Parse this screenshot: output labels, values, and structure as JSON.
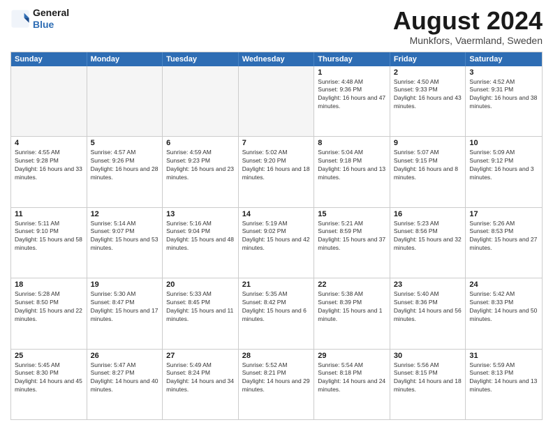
{
  "header": {
    "logo_line1": "General",
    "logo_line2": "Blue",
    "month_title": "August 2024",
    "location": "Munkfors, Vaermland, Sweden"
  },
  "days_of_week": [
    "Sunday",
    "Monday",
    "Tuesday",
    "Wednesday",
    "Thursday",
    "Friday",
    "Saturday"
  ],
  "weeks": [
    [
      {
        "day": "",
        "empty": true
      },
      {
        "day": "",
        "empty": true
      },
      {
        "day": "",
        "empty": true
      },
      {
        "day": "",
        "empty": true
      },
      {
        "day": "1",
        "sunrise": "4:48 AM",
        "sunset": "9:36 PM",
        "daylight": "16 hours and 47 minutes."
      },
      {
        "day": "2",
        "sunrise": "4:50 AM",
        "sunset": "9:33 PM",
        "daylight": "16 hours and 43 minutes."
      },
      {
        "day": "3",
        "sunrise": "4:52 AM",
        "sunset": "9:31 PM",
        "daylight": "16 hours and 38 minutes."
      }
    ],
    [
      {
        "day": "4",
        "sunrise": "4:55 AM",
        "sunset": "9:28 PM",
        "daylight": "16 hours and 33 minutes."
      },
      {
        "day": "5",
        "sunrise": "4:57 AM",
        "sunset": "9:26 PM",
        "daylight": "16 hours and 28 minutes."
      },
      {
        "day": "6",
        "sunrise": "4:59 AM",
        "sunset": "9:23 PM",
        "daylight": "16 hours and 23 minutes."
      },
      {
        "day": "7",
        "sunrise": "5:02 AM",
        "sunset": "9:20 PM",
        "daylight": "16 hours and 18 minutes."
      },
      {
        "day": "8",
        "sunrise": "5:04 AM",
        "sunset": "9:18 PM",
        "daylight": "16 hours and 13 minutes."
      },
      {
        "day": "9",
        "sunrise": "5:07 AM",
        "sunset": "9:15 PM",
        "daylight": "16 hours and 8 minutes."
      },
      {
        "day": "10",
        "sunrise": "5:09 AM",
        "sunset": "9:12 PM",
        "daylight": "16 hours and 3 minutes."
      }
    ],
    [
      {
        "day": "11",
        "sunrise": "5:11 AM",
        "sunset": "9:10 PM",
        "daylight": "15 hours and 58 minutes."
      },
      {
        "day": "12",
        "sunrise": "5:14 AM",
        "sunset": "9:07 PM",
        "daylight": "15 hours and 53 minutes."
      },
      {
        "day": "13",
        "sunrise": "5:16 AM",
        "sunset": "9:04 PM",
        "daylight": "15 hours and 48 minutes."
      },
      {
        "day": "14",
        "sunrise": "5:19 AM",
        "sunset": "9:02 PM",
        "daylight": "15 hours and 42 minutes."
      },
      {
        "day": "15",
        "sunrise": "5:21 AM",
        "sunset": "8:59 PM",
        "daylight": "15 hours and 37 minutes."
      },
      {
        "day": "16",
        "sunrise": "5:23 AM",
        "sunset": "8:56 PM",
        "daylight": "15 hours and 32 minutes."
      },
      {
        "day": "17",
        "sunrise": "5:26 AM",
        "sunset": "8:53 PM",
        "daylight": "15 hours and 27 minutes."
      }
    ],
    [
      {
        "day": "18",
        "sunrise": "5:28 AM",
        "sunset": "8:50 PM",
        "daylight": "15 hours and 22 minutes."
      },
      {
        "day": "19",
        "sunrise": "5:30 AM",
        "sunset": "8:47 PM",
        "daylight": "15 hours and 17 minutes."
      },
      {
        "day": "20",
        "sunrise": "5:33 AM",
        "sunset": "8:45 PM",
        "daylight": "15 hours and 11 minutes."
      },
      {
        "day": "21",
        "sunrise": "5:35 AM",
        "sunset": "8:42 PM",
        "daylight": "15 hours and 6 minutes."
      },
      {
        "day": "22",
        "sunrise": "5:38 AM",
        "sunset": "8:39 PM",
        "daylight": "15 hours and 1 minute."
      },
      {
        "day": "23",
        "sunrise": "5:40 AM",
        "sunset": "8:36 PM",
        "daylight": "14 hours and 56 minutes."
      },
      {
        "day": "24",
        "sunrise": "5:42 AM",
        "sunset": "8:33 PM",
        "daylight": "14 hours and 50 minutes."
      }
    ],
    [
      {
        "day": "25",
        "sunrise": "5:45 AM",
        "sunset": "8:30 PM",
        "daylight": "14 hours and 45 minutes."
      },
      {
        "day": "26",
        "sunrise": "5:47 AM",
        "sunset": "8:27 PM",
        "daylight": "14 hours and 40 minutes."
      },
      {
        "day": "27",
        "sunrise": "5:49 AM",
        "sunset": "8:24 PM",
        "daylight": "14 hours and 34 minutes."
      },
      {
        "day": "28",
        "sunrise": "5:52 AM",
        "sunset": "8:21 PM",
        "daylight": "14 hours and 29 minutes."
      },
      {
        "day": "29",
        "sunrise": "5:54 AM",
        "sunset": "8:18 PM",
        "daylight": "14 hours and 24 minutes."
      },
      {
        "day": "30",
        "sunrise": "5:56 AM",
        "sunset": "8:15 PM",
        "daylight": "14 hours and 18 minutes."
      },
      {
        "day": "31",
        "sunrise": "5:59 AM",
        "sunset": "8:13 PM",
        "daylight": "14 hours and 13 minutes."
      }
    ]
  ]
}
